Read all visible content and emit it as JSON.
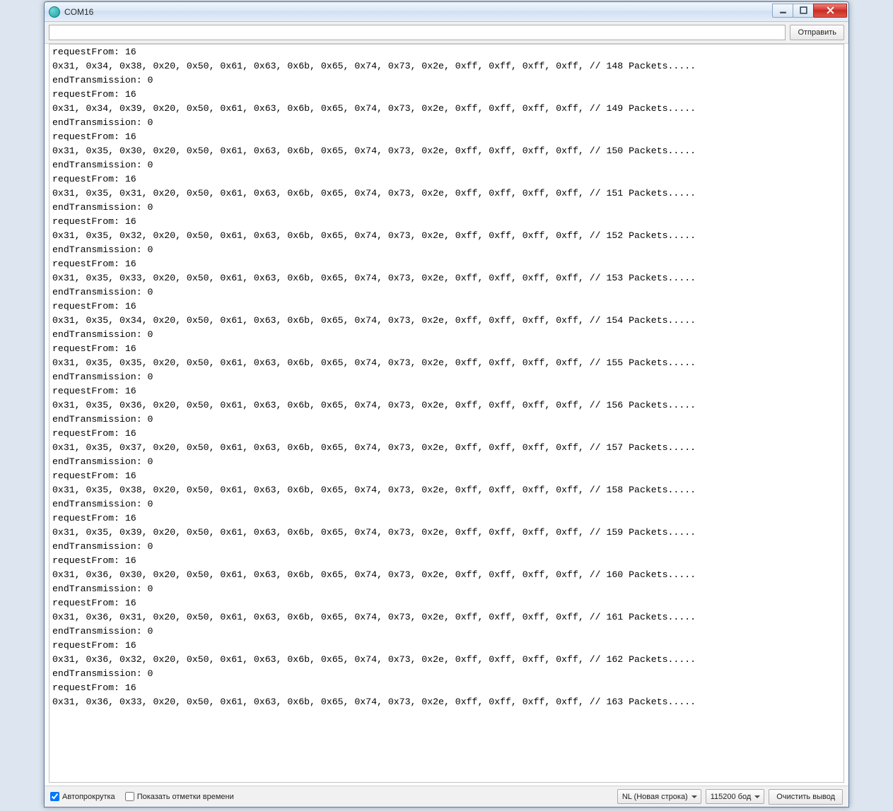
{
  "window": {
    "title": "COM16"
  },
  "toolbar": {
    "input_value": "",
    "send_label": "Отправить"
  },
  "console_lines": [
    "requestFrom: 16",
    "0x31, 0x34, 0x38, 0x20, 0x50, 0x61, 0x63, 0x6b, 0x65, 0x74, 0x73, 0x2e, 0xff, 0xff, 0xff, 0xff, // 148 Packets.....",
    "endTransmission: 0",
    "requestFrom: 16",
    "0x31, 0x34, 0x39, 0x20, 0x50, 0x61, 0x63, 0x6b, 0x65, 0x74, 0x73, 0x2e, 0xff, 0xff, 0xff, 0xff, // 149 Packets.....",
    "endTransmission: 0",
    "requestFrom: 16",
    "0x31, 0x35, 0x30, 0x20, 0x50, 0x61, 0x63, 0x6b, 0x65, 0x74, 0x73, 0x2e, 0xff, 0xff, 0xff, 0xff, // 150 Packets.....",
    "endTransmission: 0",
    "requestFrom: 16",
    "0x31, 0x35, 0x31, 0x20, 0x50, 0x61, 0x63, 0x6b, 0x65, 0x74, 0x73, 0x2e, 0xff, 0xff, 0xff, 0xff, // 151 Packets.....",
    "endTransmission: 0",
    "requestFrom: 16",
    "0x31, 0x35, 0x32, 0x20, 0x50, 0x61, 0x63, 0x6b, 0x65, 0x74, 0x73, 0x2e, 0xff, 0xff, 0xff, 0xff, // 152 Packets.....",
    "endTransmission: 0",
    "requestFrom: 16",
    "0x31, 0x35, 0x33, 0x20, 0x50, 0x61, 0x63, 0x6b, 0x65, 0x74, 0x73, 0x2e, 0xff, 0xff, 0xff, 0xff, // 153 Packets.....",
    "endTransmission: 0",
    "requestFrom: 16",
    "0x31, 0x35, 0x34, 0x20, 0x50, 0x61, 0x63, 0x6b, 0x65, 0x74, 0x73, 0x2e, 0xff, 0xff, 0xff, 0xff, // 154 Packets.....",
    "endTransmission: 0",
    "requestFrom: 16",
    "0x31, 0x35, 0x35, 0x20, 0x50, 0x61, 0x63, 0x6b, 0x65, 0x74, 0x73, 0x2e, 0xff, 0xff, 0xff, 0xff, // 155 Packets.....",
    "endTransmission: 0",
    "requestFrom: 16",
    "0x31, 0x35, 0x36, 0x20, 0x50, 0x61, 0x63, 0x6b, 0x65, 0x74, 0x73, 0x2e, 0xff, 0xff, 0xff, 0xff, // 156 Packets.....",
    "endTransmission: 0",
    "requestFrom: 16",
    "0x31, 0x35, 0x37, 0x20, 0x50, 0x61, 0x63, 0x6b, 0x65, 0x74, 0x73, 0x2e, 0xff, 0xff, 0xff, 0xff, // 157 Packets.....",
    "endTransmission: 0",
    "requestFrom: 16",
    "0x31, 0x35, 0x38, 0x20, 0x50, 0x61, 0x63, 0x6b, 0x65, 0x74, 0x73, 0x2e, 0xff, 0xff, 0xff, 0xff, // 158 Packets.....",
    "endTransmission: 0",
    "requestFrom: 16",
    "0x31, 0x35, 0x39, 0x20, 0x50, 0x61, 0x63, 0x6b, 0x65, 0x74, 0x73, 0x2e, 0xff, 0xff, 0xff, 0xff, // 159 Packets.....",
    "endTransmission: 0",
    "requestFrom: 16",
    "0x31, 0x36, 0x30, 0x20, 0x50, 0x61, 0x63, 0x6b, 0x65, 0x74, 0x73, 0x2e, 0xff, 0xff, 0xff, 0xff, // 160 Packets.....",
    "endTransmission: 0",
    "requestFrom: 16",
    "0x31, 0x36, 0x31, 0x20, 0x50, 0x61, 0x63, 0x6b, 0x65, 0x74, 0x73, 0x2e, 0xff, 0xff, 0xff, 0xff, // 161 Packets.....",
    "endTransmission: 0",
    "requestFrom: 16",
    "0x31, 0x36, 0x32, 0x20, 0x50, 0x61, 0x63, 0x6b, 0x65, 0x74, 0x73, 0x2e, 0xff, 0xff, 0xff, 0xff, // 162 Packets.....",
    "endTransmission: 0",
    "requestFrom: 16",
    "0x31, 0x36, 0x33, 0x20, 0x50, 0x61, 0x63, 0x6b, 0x65, 0x74, 0x73, 0x2e, 0xff, 0xff, 0xff, 0xff, // 163 Packets....."
  ],
  "status": {
    "autoscroll_label": "Автопрокрутка",
    "autoscroll_checked": true,
    "timestamp_label": "Показать отметки времени",
    "timestamp_checked": false,
    "line_ending": "NL (Новая строка)",
    "baud": "115200 бод",
    "clear_label": "Очистить вывод"
  }
}
